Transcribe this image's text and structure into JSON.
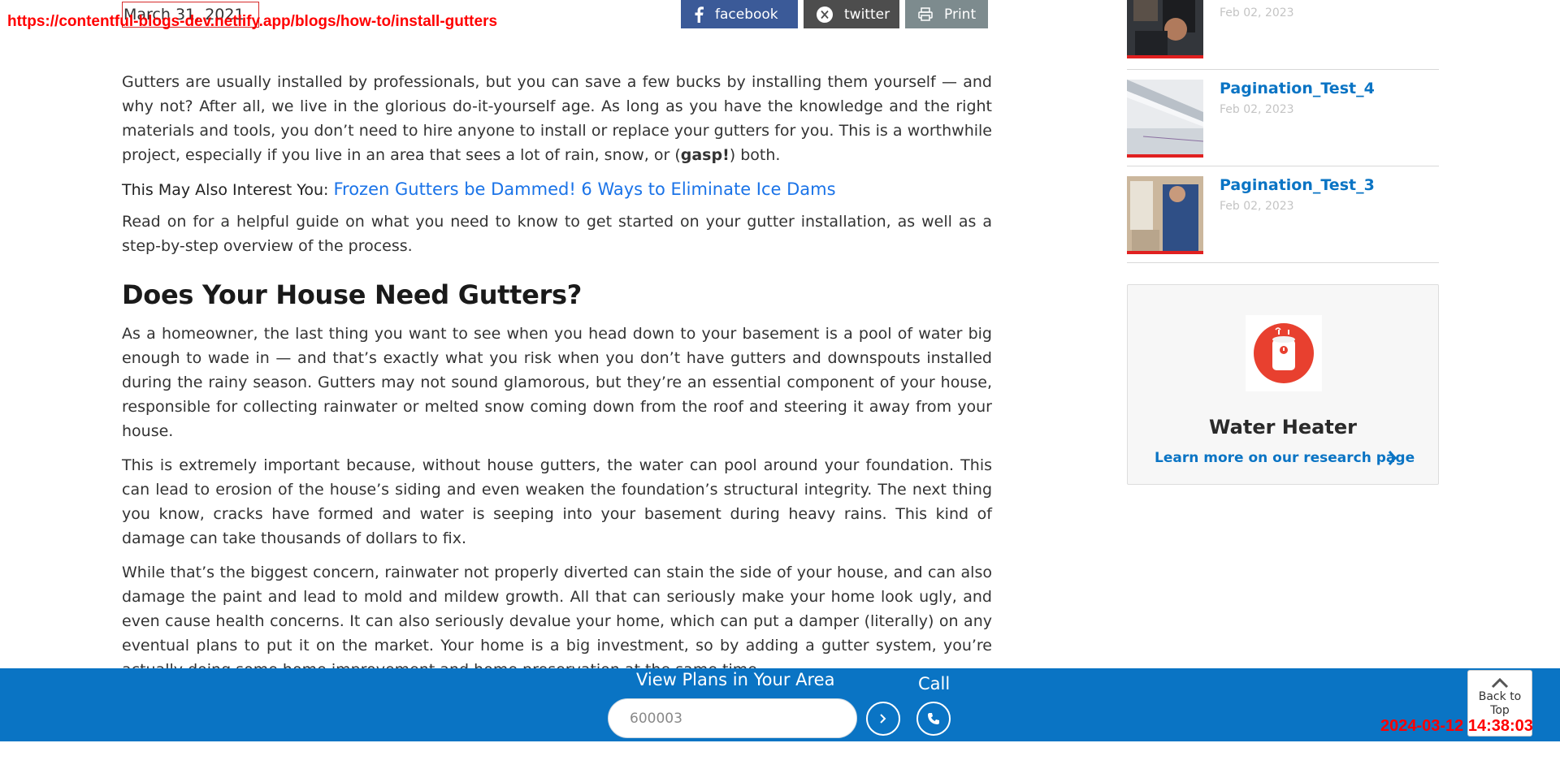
{
  "overlay": {
    "url": "https://contentful-blogs-dev.netlify.app/blogs/how-to/install-gutters",
    "timestamp": "2024-03-12 14:38:03"
  },
  "article": {
    "date": "March 31, 2021",
    "share": {
      "facebook_label": "facebook",
      "twitter_label": "twitter",
      "print_label": "Print"
    },
    "intro_before": "Gutters are usually installed by professionals, but you can save a few bucks by installing them yourself — and why not? After all, we live in the glorious do-it-yourself age. As long as you have the knowledge and the right materials and tools, you don’t need to hire anyone to install or replace your gutters for you. This is a worthwhile project, especially if you live in an area that sees a lot of rain, snow, or (",
    "intro_bold": "gasp!",
    "intro_after": ") both.",
    "interest_label": "This May Also Interest You:",
    "interest_link": "Frozen Gutters be Dammed! 6 Ways to Eliminate Ice Dams",
    "read_on": "Read on for a helpful guide on what you need to know to get started on your gutter installation, as well as a step-by-step overview of the process.",
    "heading": "Does Your House Need Gutters?",
    "para_1": "As a homeowner, the last thing you want to see when you head down to your basement is a pool of water big enough to wade in — and that’s exactly what you risk when you don’t have gutters and downspouts installed during the rainy season. Gutters may not sound glamorous, but they’re an essential component of your house, responsible for collecting rainwater or melted snow coming down from the roof and steering it away from your house.",
    "para_2": "This is extremely important because, without house gutters, the water can pool around your foundation. This can lead to erosion of the house’s siding and even weaken the foundation’s structural integrity. The next thing you know, cracks have formed and water is seeping into your basement during heavy rains. This kind of damage can take thousands of dollars to fix.",
    "para_3": "While that’s the biggest concern, rainwater not properly diverted can stain the side of your house, and can also damage the paint and lead to mold and mildew growth. All that can seriously make your home look ugly, and even cause health concerns. It can also seriously devalue your home, which can put a damper (literally) on any eventual plans to put it on the market. Your home is a big investment, so by adding a gutter system, you’re actually doing some home improvement and home preservation at the same time."
  },
  "sidebar": {
    "related": [
      {
        "title": "",
        "date": "Feb 02, 2023"
      },
      {
        "title": "Pagination_Test_4",
        "date": "Feb 02, 2023"
      },
      {
        "title": "Pagination_Test_3",
        "date": "Feb 02, 2023"
      }
    ],
    "card": {
      "title": "Water Heater",
      "link": "Learn more on our research page"
    }
  },
  "footer": {
    "plans_label": "View Plans in Your Area",
    "zip_value": "600003",
    "call_label": "Call",
    "back_to_top": "Back to Top"
  },
  "colors": {
    "brand_blue": "#0a74c4",
    "accent_red": "#e02020",
    "facebook": "#3b5a98",
    "twitter": "#4d4d4d",
    "print": "#7d8b8e"
  }
}
